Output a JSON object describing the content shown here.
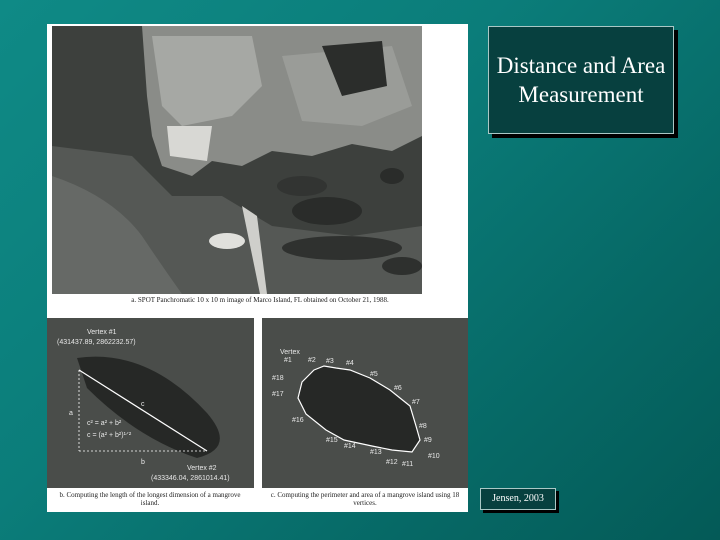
{
  "slide": {
    "title": "Distance and Area Measurement",
    "credit": "Jensen, 2003"
  },
  "figure": {
    "caption_a": "a. SPOT Panchromatic 10 x 10 m image of Marco Island, FL obtained on October 21, 1988.",
    "caption_b": "b. Computing the length of the longest dimension of a mangrove island.",
    "caption_c": "c. Computing the perimeter and area of a mangrove island using 18 vertices.",
    "panel_b": {
      "vertex1_label": "Vertex #1",
      "vertex1_coords": "(431437.89, 2862232.57)",
      "vertex2_label": "Vertex #2",
      "vertex2_coords": "(433346.04, 2861014.41)",
      "side_a": "a",
      "side_b": "b",
      "side_c": "c",
      "formula1": "c² = a² + b²",
      "formula2": "c = (a² + b²)¹ᐟ²"
    },
    "panel_c": {
      "vertex_label": "Vertex",
      "vertices": [
        "#1",
        "#2",
        "#3",
        "#4",
        "#5",
        "#6",
        "#7",
        "#8",
        "#9",
        "#10",
        "#11",
        "#12",
        "#13",
        "#14",
        "#15",
        "#16",
        "#17",
        "#18"
      ]
    }
  }
}
